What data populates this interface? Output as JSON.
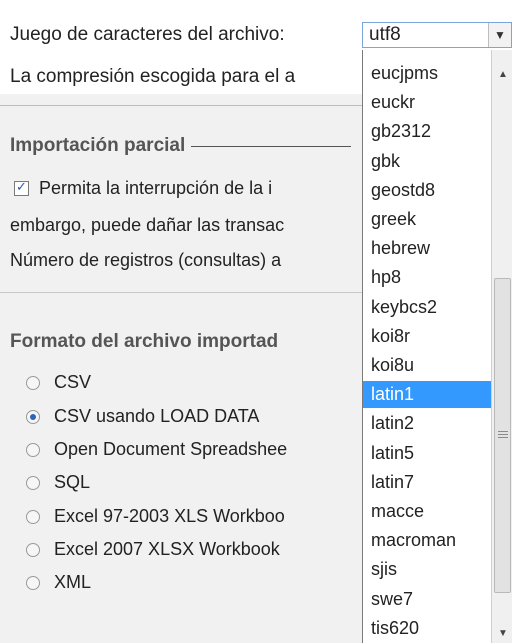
{
  "charset_label": "Juego de caracteres del archivo:",
  "compression_text": "La compresión escogida para el a",
  "partial_import": {
    "title": "Importación parcial",
    "checkbox_label": "Permita la interrupción de la i",
    "line2": "embargo, puede dañar las transac",
    "line3": "Número de registros (consultas) a"
  },
  "format_section": {
    "title": "Formato del archivo importad",
    "options": [
      {
        "label": "CSV",
        "checked": false
      },
      {
        "label": "CSV usando LOAD DATA",
        "checked": true
      },
      {
        "label": "Open Document Spreadshee",
        "checked": false
      },
      {
        "label": "SQL",
        "checked": false
      },
      {
        "label": "Excel 97-2003 XLS Workboo",
        "checked": false
      },
      {
        "label": "Excel 2007 XLSX Workbook",
        "checked": false
      },
      {
        "label": "XML",
        "checked": false
      }
    ]
  },
  "select": {
    "value": "utf8",
    "options": [
      "eucjpms",
      "euckr",
      "gb2312",
      "gbk",
      "geostd8",
      "greek",
      "hebrew",
      "hp8",
      "keybcs2",
      "koi8r",
      "koi8u",
      "latin1",
      "latin2",
      "latin5",
      "latin7",
      "macce",
      "macroman",
      "sjis",
      "swe7",
      "tis620"
    ],
    "highlighted": "latin1"
  },
  "colors": {
    "highlight": "#3399ff",
    "select_border": "#7aa7da"
  }
}
